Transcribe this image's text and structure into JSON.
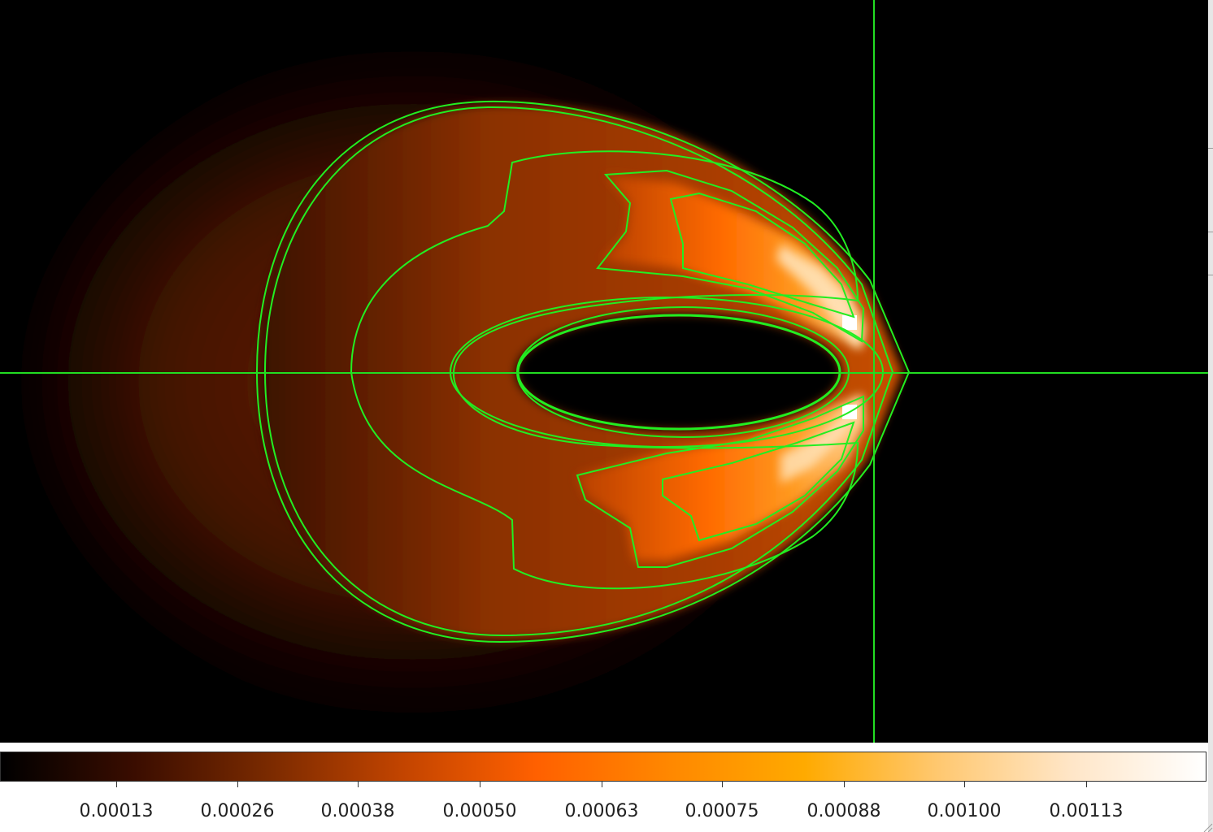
{
  "image_viewer": {
    "colormap_name": "heat",
    "crosshair_color": "#22dd22",
    "contour_color": "#22ee22",
    "background_color": "#000000"
  },
  "colorbar": {
    "stops": [
      "#000000",
      "#3a0d00",
      "#7a2a00",
      "#c24400",
      "#ff6000",
      "#ff8800",
      "#ffaa00",
      "#ffc870",
      "#ffe6c8",
      "#ffffff"
    ],
    "tick_labels": [
      "0.00013",
      "0.00026",
      "0.00038",
      "0.00050",
      "0.00063",
      "0.00075",
      "0.00088",
      "0.00100",
      "0.00113"
    ]
  },
  "icons": {
    "resize_grip": "resize-grip-icon"
  }
}
